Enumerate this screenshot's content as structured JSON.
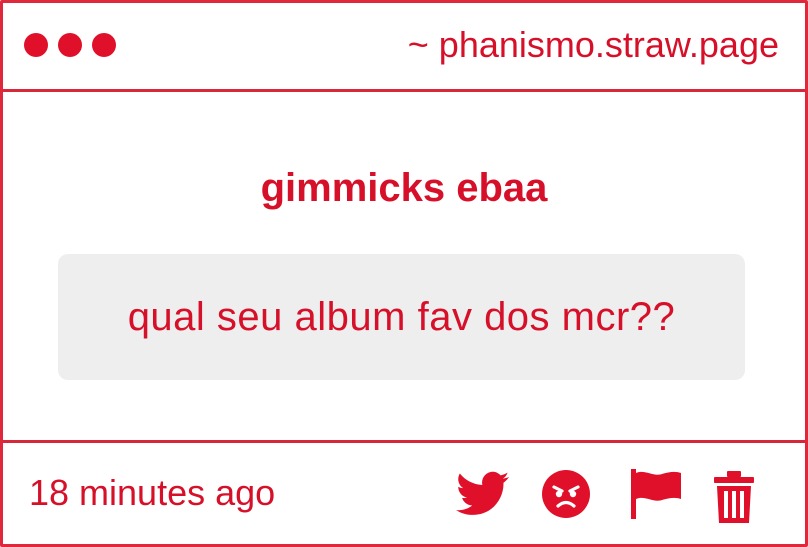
{
  "header": {
    "site": "~ phanismo.straw.page"
  },
  "card": {
    "prompt": "gimmicks ebaa",
    "question": "qual seu album fav dos mcr??"
  },
  "footer": {
    "timestamp": "18 minutes ago",
    "icons": [
      "twitter-icon",
      "angry-face-icon",
      "flag-icon",
      "trash-icon"
    ]
  },
  "colors": {
    "accent": "#d7102a",
    "border": "#d7283a",
    "question_bg": "#efeeef"
  }
}
